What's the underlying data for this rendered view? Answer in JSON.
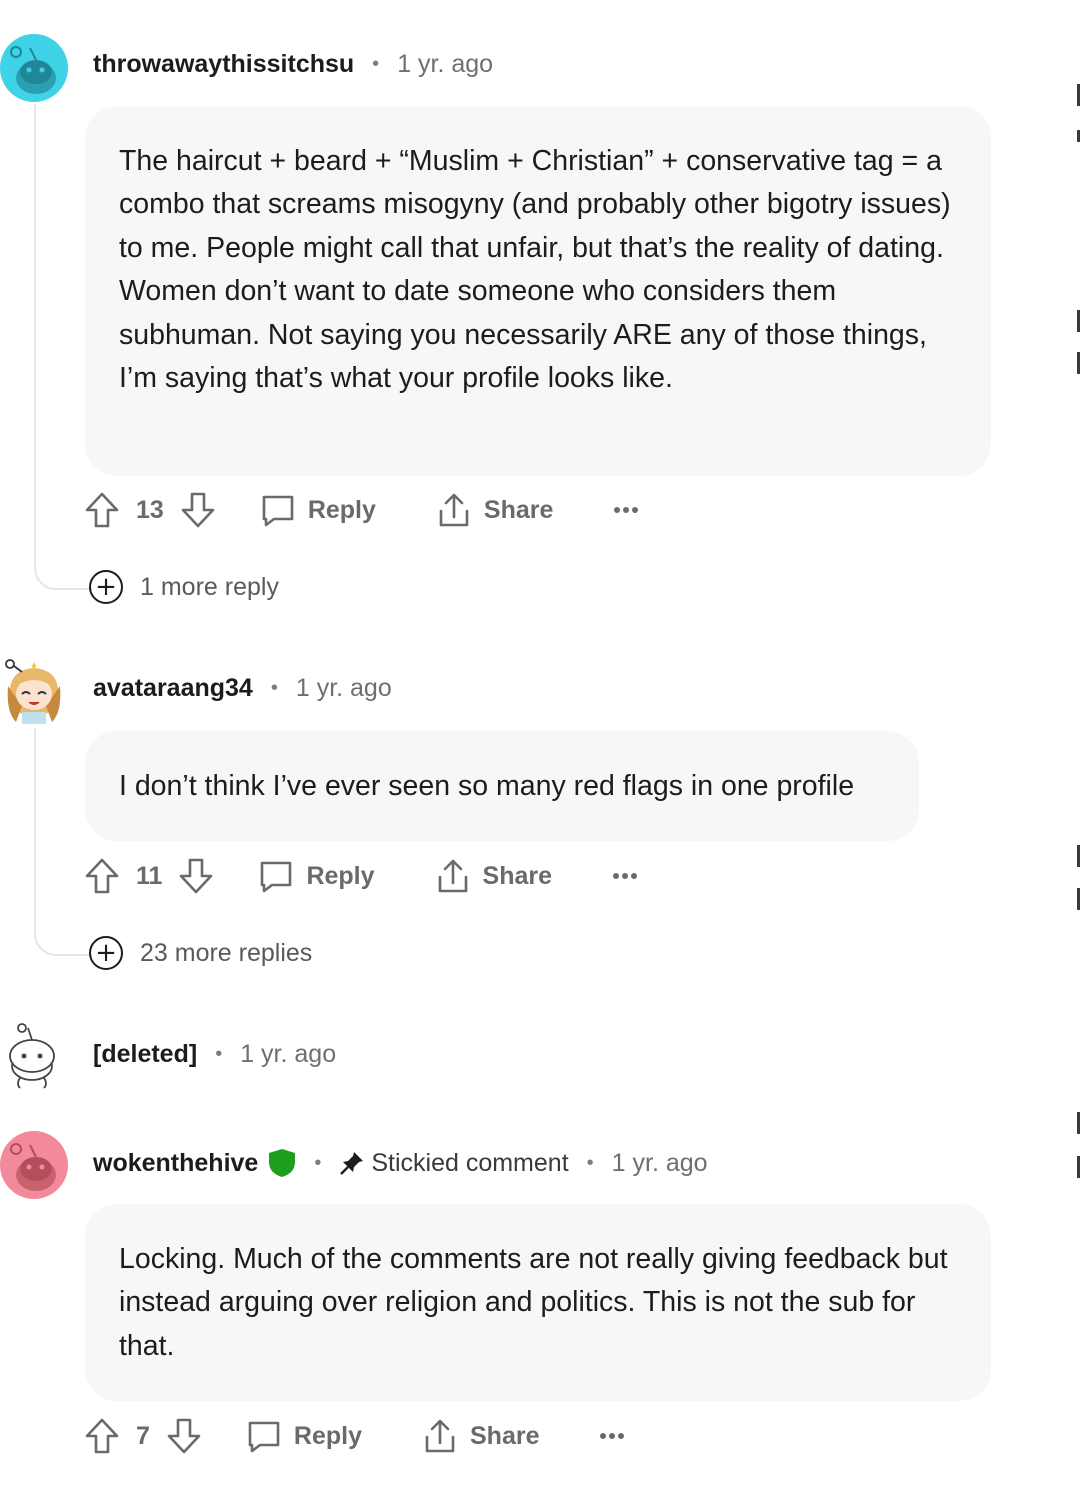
{
  "comments": [
    {
      "username": "throwawaythissitchsu",
      "time": "1 yr. ago",
      "body": "The haircut + beard + “Muslim + Christian” + conservative tag = a combo that screams misogyny (and probably other bigotry issues) to me. People might call that unfair, but that’s the reality of dating. Women don’t want to date someone who considers them subhuman. Not saying you necessarily ARE any of those things, I’m saying that’s what your profile looks like.",
      "votes": "13",
      "reply_label": "Reply",
      "share_label": "Share",
      "more_replies": "1 more reply",
      "avatar_color": "#3ed3e6"
    },
    {
      "username": "avataraang34",
      "time": "1 yr. ago",
      "body": "I don’t think I’ve ever seen so many red flags in one profile",
      "votes": "11",
      "reply_label": "Reply",
      "share_label": "Share",
      "more_replies": "23 more replies"
    },
    {
      "username": "[deleted]",
      "time": "1 yr. ago"
    },
    {
      "username": "wokenthehive",
      "stickied_label": "Stickied comment",
      "time": "1 yr. ago",
      "body": "Locking. Much of the comments are not really giving feedback but instead arguing over religion and politics. This is not the sub for that.",
      "votes": "7",
      "reply_label": "Reply",
      "share_label": "Share",
      "avatar_color": "#f28a9b",
      "mod_badge_color": "#1e9e1e"
    }
  ],
  "more_options_icon": "ellipsis-icon"
}
